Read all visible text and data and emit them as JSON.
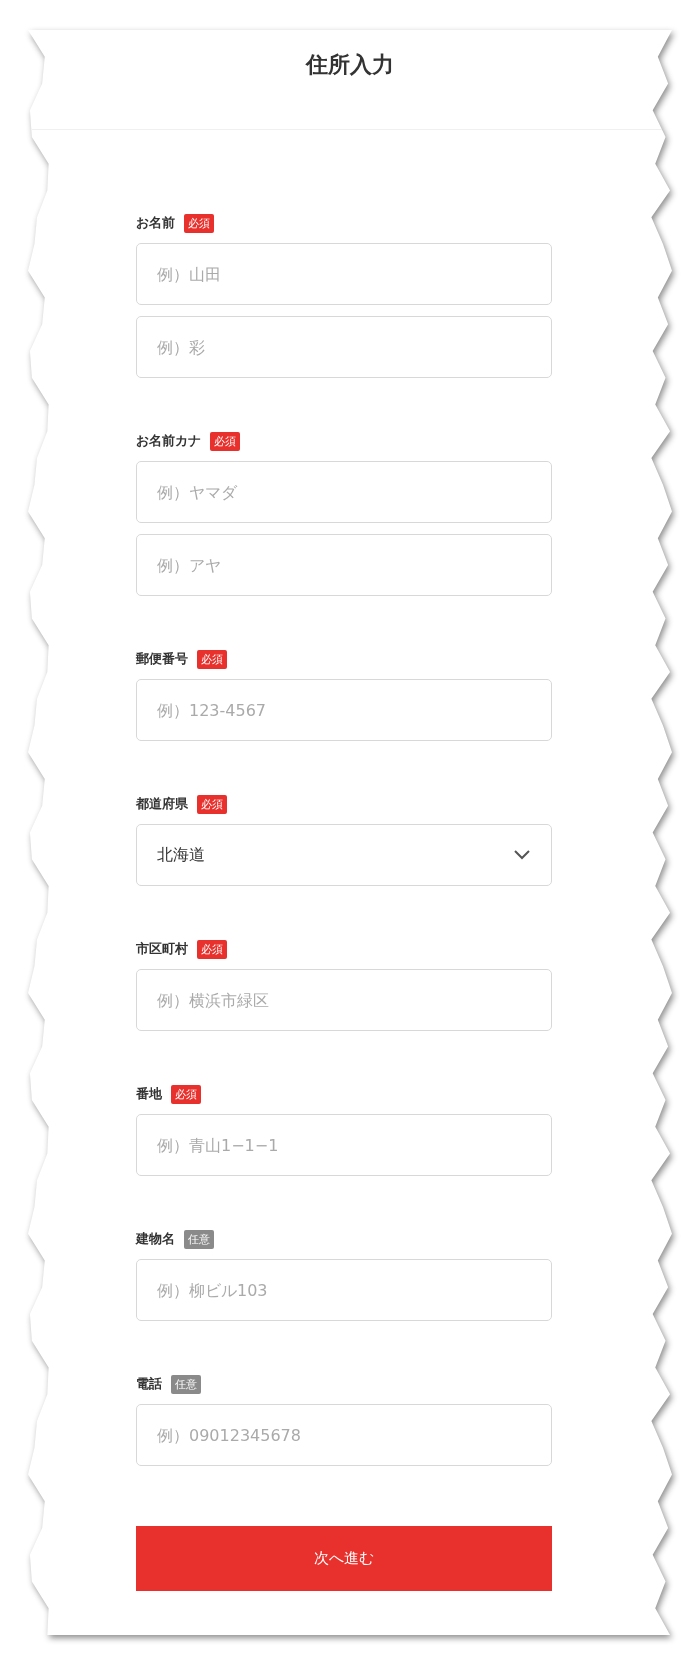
{
  "title": "住所入力",
  "sections": [
    {
      "label": "お名前",
      "badge": {
        "text": "必須",
        "required": true
      },
      "fields": [
        {
          "kind": "text",
          "placeholder": "例）山田"
        },
        {
          "kind": "text",
          "placeholder": "例）彩"
        }
      ]
    },
    {
      "label": "お名前カナ",
      "badge": {
        "text": "必須",
        "required": true
      },
      "fields": [
        {
          "kind": "text",
          "placeholder": "例）ヤマダ"
        },
        {
          "kind": "text",
          "placeholder": "例）アヤ"
        }
      ]
    },
    {
      "label": "郵便番号",
      "badge": {
        "text": "必須",
        "required": true
      },
      "fields": [
        {
          "kind": "text",
          "placeholder": "例）123-4567"
        }
      ]
    },
    {
      "label": "都道府県",
      "badge": {
        "text": "必須",
        "required": true
      },
      "fields": [
        {
          "kind": "select",
          "value": "北海道"
        }
      ]
    },
    {
      "label": "市区町村",
      "badge": {
        "text": "必須",
        "required": true
      },
      "fields": [
        {
          "kind": "text",
          "placeholder": "例）横浜市緑区"
        }
      ]
    },
    {
      "label": "番地",
      "badge": {
        "text": "必須",
        "required": true
      },
      "fields": [
        {
          "kind": "text",
          "placeholder": "例）青山1−1−1"
        }
      ]
    },
    {
      "label": "建物名",
      "badge": {
        "text": "任意",
        "required": false
      },
      "fields": [
        {
          "kind": "text",
          "placeholder": "例）柳ビル103"
        }
      ]
    },
    {
      "label": "電話",
      "badge": {
        "text": "任意",
        "required": false
      },
      "fields": [
        {
          "kind": "text",
          "placeholder": "例）09012345678"
        }
      ]
    }
  ],
  "submit": "次へ進む"
}
